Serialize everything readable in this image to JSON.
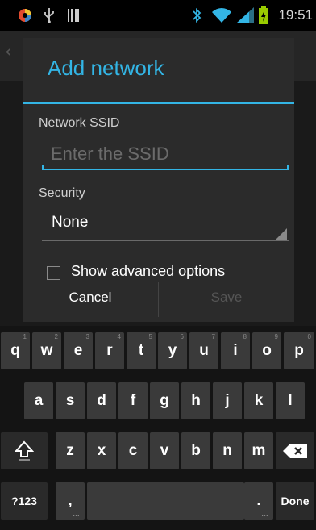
{
  "status_bar": {
    "time": "19:51",
    "icons": [
      "app-icon",
      "usb-icon",
      "barcode-icon",
      "bluetooth-icon",
      "wifi-icon",
      "signal-icon",
      "battery-charging-icon"
    ]
  },
  "dialog": {
    "title": "Add network",
    "ssid_label": "Network SSID",
    "ssid_value": "",
    "ssid_placeholder": "Enter the SSID",
    "security_label": "Security",
    "security_value": "None",
    "advanced_label": "Show advanced options",
    "advanced_checked": false,
    "cancel_label": "Cancel",
    "save_label": "Save"
  },
  "keyboard": {
    "row1": [
      {
        "key": "q",
        "hint": "1"
      },
      {
        "key": "w",
        "hint": "2"
      },
      {
        "key": "e",
        "hint": "3"
      },
      {
        "key": "r",
        "hint": "4"
      },
      {
        "key": "t",
        "hint": "5"
      },
      {
        "key": "y",
        "hint": "6"
      },
      {
        "key": "u",
        "hint": "7"
      },
      {
        "key": "i",
        "hint": "8"
      },
      {
        "key": "o",
        "hint": "9"
      },
      {
        "key": "p",
        "hint": "0"
      }
    ],
    "row2": [
      "a",
      "s",
      "d",
      "f",
      "g",
      "h",
      "j",
      "k",
      "l"
    ],
    "row3": [
      "z",
      "x",
      "c",
      "v",
      "b",
      "n",
      "m"
    ],
    "symbols_label": "?123",
    "comma": ",",
    "period": ".",
    "done_label": "Done"
  },
  "colors": {
    "accent": "#33b5e5",
    "dialog_bg": "#2b2b2b",
    "key_bg": "#3a3a3a"
  }
}
